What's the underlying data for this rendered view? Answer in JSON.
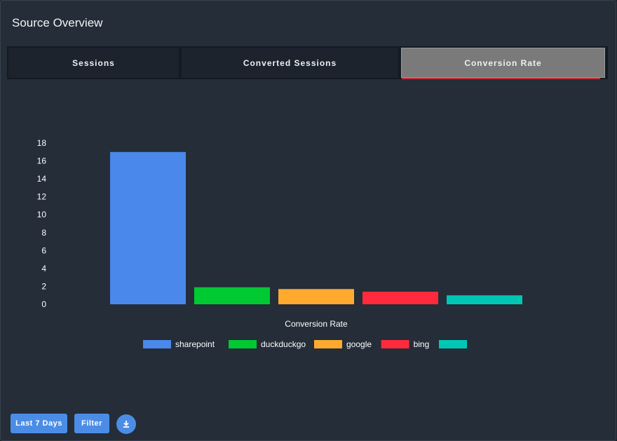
{
  "panel": {
    "title": "Source Overview"
  },
  "tabs": [
    {
      "label": "Sessions",
      "active": false
    },
    {
      "label": "Converted Sessions",
      "active": false
    },
    {
      "label": "Conversion Rate",
      "active": true
    }
  ],
  "chart_data": {
    "type": "bar",
    "xlabel": "Conversion Rate",
    "ylim": [
      0,
      18
    ],
    "yticks": [
      0,
      2,
      4,
      6,
      8,
      10,
      12,
      14,
      16,
      18
    ],
    "grid": false,
    "legend_position": "bottom",
    "categories": [
      "sharepoint",
      "duckduckgo",
      "google",
      "bing",
      ""
    ],
    "values": [
      17.0,
      1.9,
      1.7,
      1.4,
      1.0
    ],
    "colors": [
      "#4a88ec",
      "#00c932",
      "#ffaa2e",
      "#ff2a3c",
      "#00c7b3"
    ]
  },
  "controls": {
    "date_range_label": "Last 7 Days",
    "filter_label": "Filter",
    "download_icon": "download-icon"
  }
}
